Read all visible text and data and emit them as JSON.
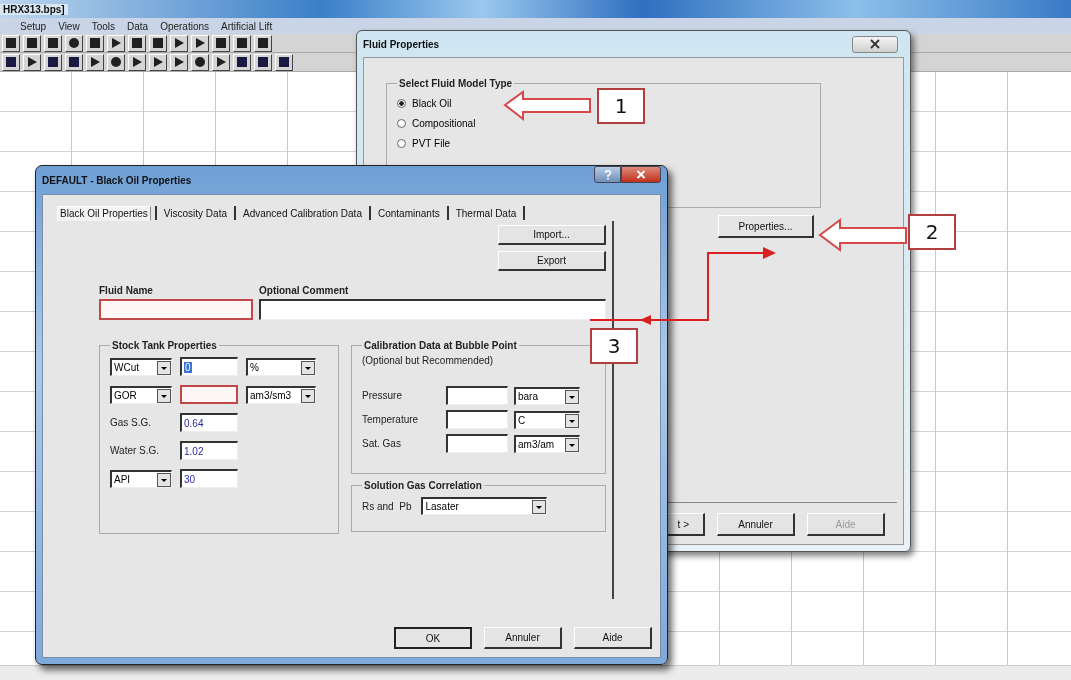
{
  "app": {
    "title": "HRX313.bps]",
    "menu": [
      "Setup",
      "View",
      "Tools",
      "Data",
      "Operations",
      "Artificial Lift"
    ]
  },
  "fluid_dialog": {
    "title": "Fluid Properties",
    "group_title": "Select Fluid Model Type",
    "options": [
      {
        "label": "Black Oil",
        "selected": true
      },
      {
        "label": "Compositional",
        "selected": false
      },
      {
        "label": "PVT File",
        "selected": false
      }
    ],
    "properties_button": "Properties...",
    "buttons": [
      {
        "label": "t >",
        "disabled": false
      },
      {
        "label": "Annuler",
        "disabled": false
      },
      {
        "label": "Aide",
        "disabled": true
      }
    ]
  },
  "black_oil_dialog": {
    "title": "DEFAULT - Black Oil Properties",
    "tabs": [
      {
        "label": "Black Oil Properties",
        "selected": true
      },
      {
        "label": "Viscosity Data",
        "selected": false
      },
      {
        "label": "Advanced Calibration Data",
        "selected": false
      },
      {
        "label": "Contaminants",
        "selected": false
      },
      {
        "label": "Thermal Data",
        "selected": false
      }
    ],
    "side_buttons": [
      "Import...",
      "Export"
    ],
    "fluid_name": {
      "label": "Fluid Name",
      "error": true
    },
    "comment": {
      "label": "Optional Comment",
      "error": false
    },
    "stock_tank": {
      "title": "Stock Tank Properties",
      "rows": [
        {
          "kind": "select",
          "name": "WCut",
          "value": "0",
          "highlighted": true,
          "error": false,
          "unit": "%"
        },
        {
          "kind": "select",
          "name": "GOR",
          "error": true,
          "unit": "am3/sm3"
        },
        {
          "kind": "label",
          "name": "Gas S.G.",
          "value": "0.64",
          "highlighted": false,
          "error": false
        },
        {
          "kind": "label",
          "name": "Water S.G.",
          "value": "1.02",
          "highlighted": false,
          "error": false
        },
        {
          "kind": "select",
          "name": "API",
          "value": "30",
          "highlighted": false,
          "error": false
        }
      ]
    },
    "calibration": {
      "title": "Calibration Data at Bubble Point",
      "note": "(Optional but Recommended)",
      "rows": [
        {
          "label": "Pressure",
          "unit": "bara"
        },
        {
          "label": "Temperature",
          "unit": "C"
        },
        {
          "label": "Sat. Gas",
          "unit": "am3/am"
        }
      ]
    },
    "correlation": {
      "title": "Solution Gas Correlation",
      "label": "Rs and  Pb",
      "value": "Lasater"
    },
    "buttons": [
      {
        "label": "OK",
        "default": true
      },
      {
        "label": "Annuler",
        "default": false
      },
      {
        "label": "Aide",
        "default": false
      }
    ]
  },
  "annotations": [
    {
      "number": "1"
    },
    {
      "number": "2"
    },
    {
      "number": "3"
    }
  ]
}
